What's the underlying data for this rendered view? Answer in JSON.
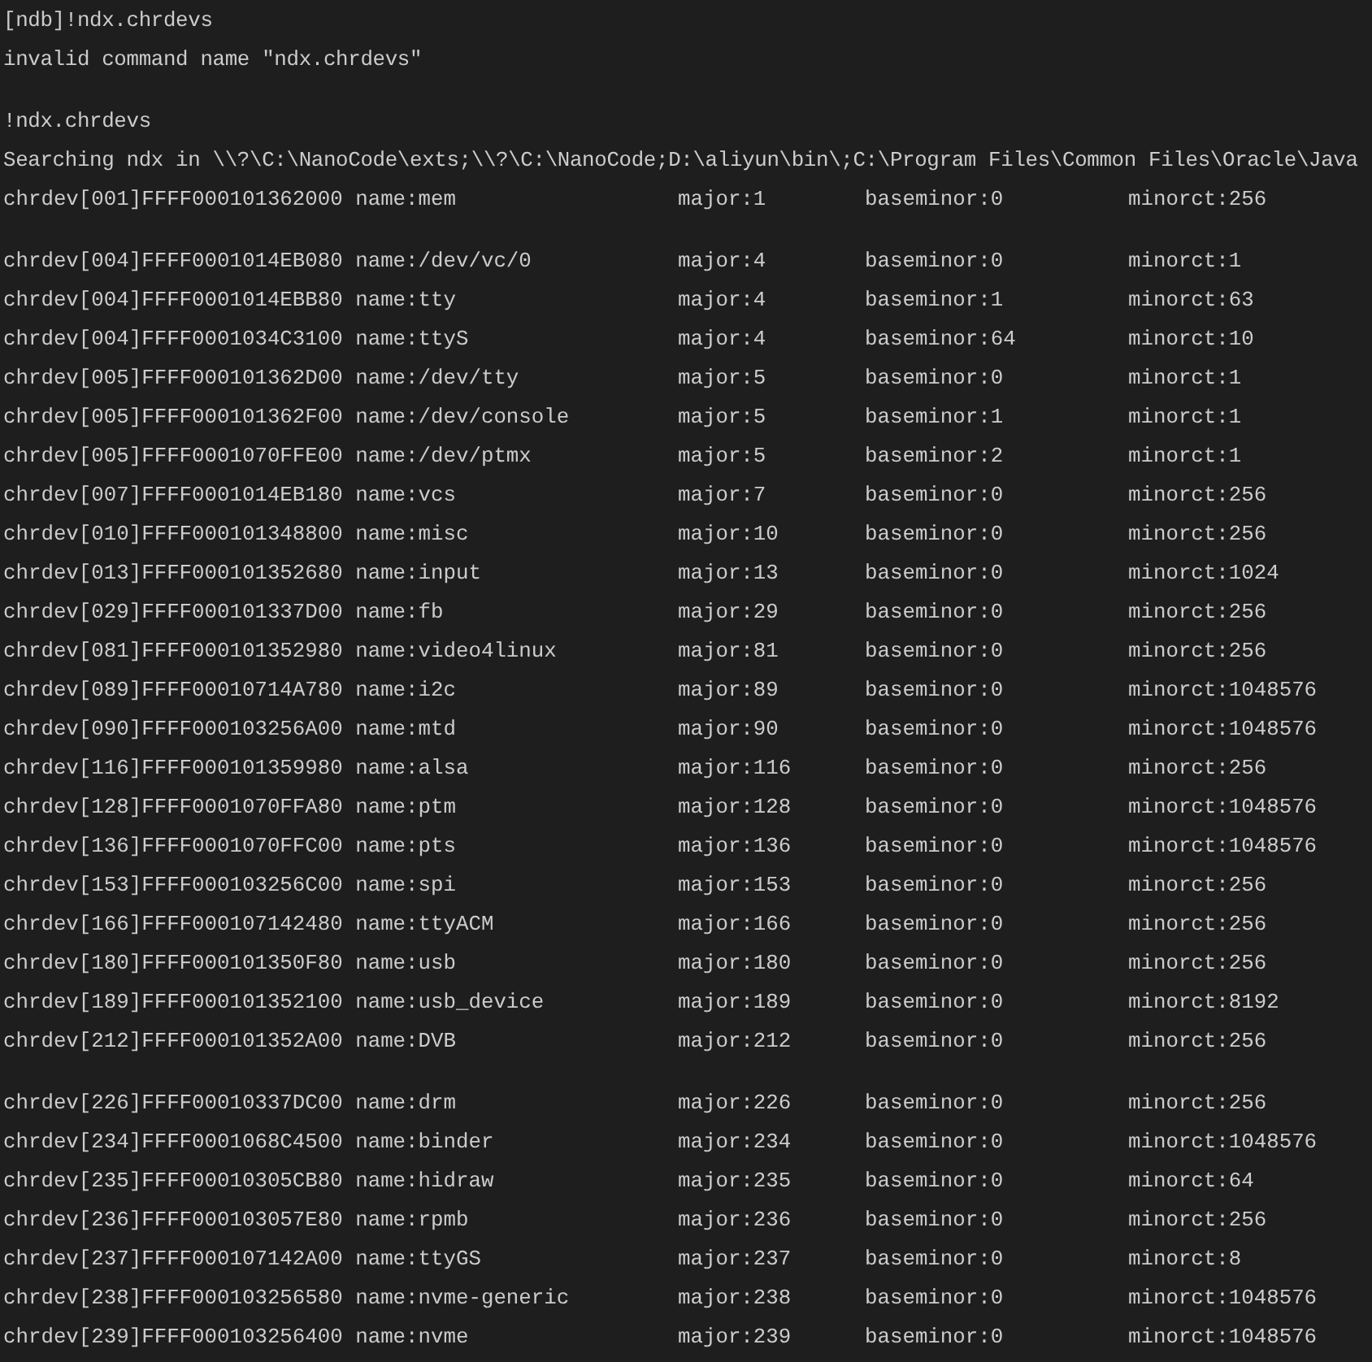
{
  "blocks": [
    {
      "lines": [
        {
          "kind": "text",
          "text": "[ndb]!ndx.chrdevs"
        },
        {
          "kind": "text",
          "text": "invalid command name \"ndx.chrdevs\""
        }
      ]
    },
    {
      "lines": [
        {
          "kind": "text",
          "text": "!ndx.chrdevs"
        },
        {
          "kind": "text",
          "text": "Searching ndx in \\\\?\\C:\\NanoCode\\exts;\\\\?\\C:\\NanoCode;D:\\aliyun\\bin\\;C:\\Program Files\\Common Files\\Oracle\\Java"
        },
        {
          "kind": "device",
          "device": "chrdev[001]FFFF000101362000 name:mem",
          "major": "major:1",
          "baseminor": "baseminor:0",
          "minorct": "minorct:256"
        }
      ]
    },
    {
      "lines": [
        {
          "kind": "device",
          "device": "chrdev[004]FFFF0001014EB080 name:/dev/vc/0",
          "major": "major:4",
          "baseminor": "baseminor:0",
          "minorct": "minorct:1"
        },
        {
          "kind": "device",
          "device": "chrdev[004]FFFF0001014EBB80 name:tty",
          "major": "major:4",
          "baseminor": "baseminor:1",
          "minorct": "minorct:63"
        },
        {
          "kind": "device",
          "device": "chrdev[004]FFFF0001034C3100 name:ttyS",
          "major": "major:4",
          "baseminor": "baseminor:64",
          "minorct": "minorct:10"
        },
        {
          "kind": "device",
          "device": "chrdev[005]FFFF000101362D00 name:/dev/tty",
          "major": "major:5",
          "baseminor": "baseminor:0",
          "minorct": "minorct:1"
        },
        {
          "kind": "device",
          "device": "chrdev[005]FFFF000101362F00 name:/dev/console",
          "major": "major:5",
          "baseminor": "baseminor:1",
          "minorct": "minorct:1"
        },
        {
          "kind": "device",
          "device": "chrdev[005]FFFF0001070FFE00 name:/dev/ptmx",
          "major": "major:5",
          "baseminor": "baseminor:2",
          "minorct": "minorct:1"
        },
        {
          "kind": "device",
          "device": "chrdev[007]FFFF0001014EB180 name:vcs",
          "major": "major:7",
          "baseminor": "baseminor:0",
          "minorct": "minorct:256"
        },
        {
          "kind": "device",
          "device": "chrdev[010]FFFF000101348800 name:misc",
          "major": "major:10",
          "baseminor": "baseminor:0",
          "minorct": "minorct:256"
        },
        {
          "kind": "device",
          "device": "chrdev[013]FFFF000101352680 name:input",
          "major": "major:13",
          "baseminor": "baseminor:0",
          "minorct": "minorct:1024"
        },
        {
          "kind": "device",
          "device": "chrdev[029]FFFF000101337D00 name:fb",
          "major": "major:29",
          "baseminor": "baseminor:0",
          "minorct": "minorct:256"
        },
        {
          "kind": "device",
          "device": "chrdev[081]FFFF000101352980 name:video4linux",
          "major": "major:81",
          "baseminor": "baseminor:0",
          "minorct": "minorct:256"
        },
        {
          "kind": "device",
          "device": "chrdev[089]FFFF00010714A780 name:i2c",
          "major": "major:89",
          "baseminor": "baseminor:0",
          "minorct": "minorct:1048576"
        },
        {
          "kind": "device",
          "device": "chrdev[090]FFFF000103256A00 name:mtd",
          "major": "major:90",
          "baseminor": "baseminor:0",
          "minorct": "minorct:1048576"
        },
        {
          "kind": "device",
          "device": "chrdev[116]FFFF000101359980 name:alsa",
          "major": "major:116",
          "baseminor": "baseminor:0",
          "minorct": "minorct:256"
        },
        {
          "kind": "device",
          "device": "chrdev[128]FFFF0001070FFA80 name:ptm",
          "major": "major:128",
          "baseminor": "baseminor:0",
          "minorct": "minorct:1048576"
        },
        {
          "kind": "device",
          "device": "chrdev[136]FFFF0001070FFC00 name:pts",
          "major": "major:136",
          "baseminor": "baseminor:0",
          "minorct": "minorct:1048576"
        },
        {
          "kind": "device",
          "device": "chrdev[153]FFFF000103256C00 name:spi",
          "major": "major:153",
          "baseminor": "baseminor:0",
          "minorct": "minorct:256"
        },
        {
          "kind": "device",
          "device": "chrdev[166]FFFF000107142480 name:ttyACM",
          "major": "major:166",
          "baseminor": "baseminor:0",
          "minorct": "minorct:256"
        },
        {
          "kind": "device",
          "device": "chrdev[180]FFFF000101350F80 name:usb",
          "major": "major:180",
          "baseminor": "baseminor:0",
          "minorct": "minorct:256"
        },
        {
          "kind": "device",
          "device": "chrdev[189]FFFF000101352100 name:usb_device",
          "major": "major:189",
          "baseminor": "baseminor:0",
          "minorct": "minorct:8192"
        },
        {
          "kind": "device",
          "device": "chrdev[212]FFFF000101352A00 name:DVB",
          "major": "major:212",
          "baseminor": "baseminor:0",
          "minorct": "minorct:256"
        }
      ]
    },
    {
      "lines": [
        {
          "kind": "device",
          "device": "chrdev[226]FFFF00010337DC00 name:drm",
          "major": "major:226",
          "baseminor": "baseminor:0",
          "minorct": "minorct:256"
        },
        {
          "kind": "device",
          "device": "chrdev[234]FFFF0001068C4500 name:binder",
          "major": "major:234",
          "baseminor": "baseminor:0",
          "minorct": "minorct:1048576"
        },
        {
          "kind": "device",
          "device": "chrdev[235]FFFF00010305CB80 name:hidraw",
          "major": "major:235",
          "baseminor": "baseminor:0",
          "minorct": "minorct:64"
        },
        {
          "kind": "device",
          "device": "chrdev[236]FFFF000103057E80 name:rpmb",
          "major": "major:236",
          "baseminor": "baseminor:0",
          "minorct": "minorct:256"
        },
        {
          "kind": "device",
          "device": "chrdev[237]FFFF000107142A00 name:ttyGS",
          "major": "major:237",
          "baseminor": "baseminor:0",
          "minorct": "minorct:8"
        },
        {
          "kind": "device",
          "device": "chrdev[238]FFFF000103256580 name:nvme-generic",
          "major": "major:238",
          "baseminor": "baseminor:0",
          "minorct": "minorct:1048576"
        },
        {
          "kind": "device",
          "device": "chrdev[239]FFFF000103256400 name:nvme",
          "major": "major:239",
          "baseminor": "baseminor:0",
          "minorct": "minorct:1048576"
        }
      ]
    }
  ]
}
